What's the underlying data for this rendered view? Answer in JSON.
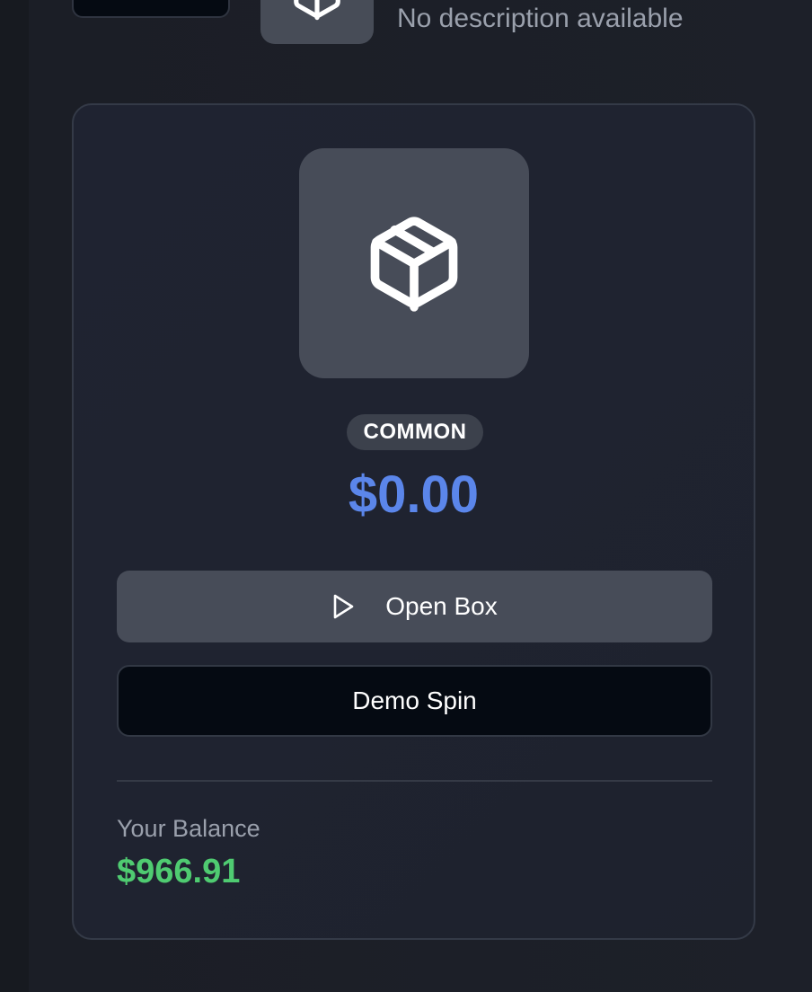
{
  "previous_item": {
    "description": "No description available",
    "icon": "package-icon"
  },
  "box": {
    "icon": "package-icon",
    "rarity": "COMMON",
    "price": "$0.00",
    "open_label": "Open Box",
    "open_icon": "play-icon",
    "demo_label": "Demo Spin"
  },
  "balance": {
    "label": "Your Balance",
    "value": "$966.91"
  },
  "colors": {
    "price": "#5b86ea",
    "balance": "#4fcb71",
    "tile": "#474c58",
    "demo_button": "#050a12"
  }
}
